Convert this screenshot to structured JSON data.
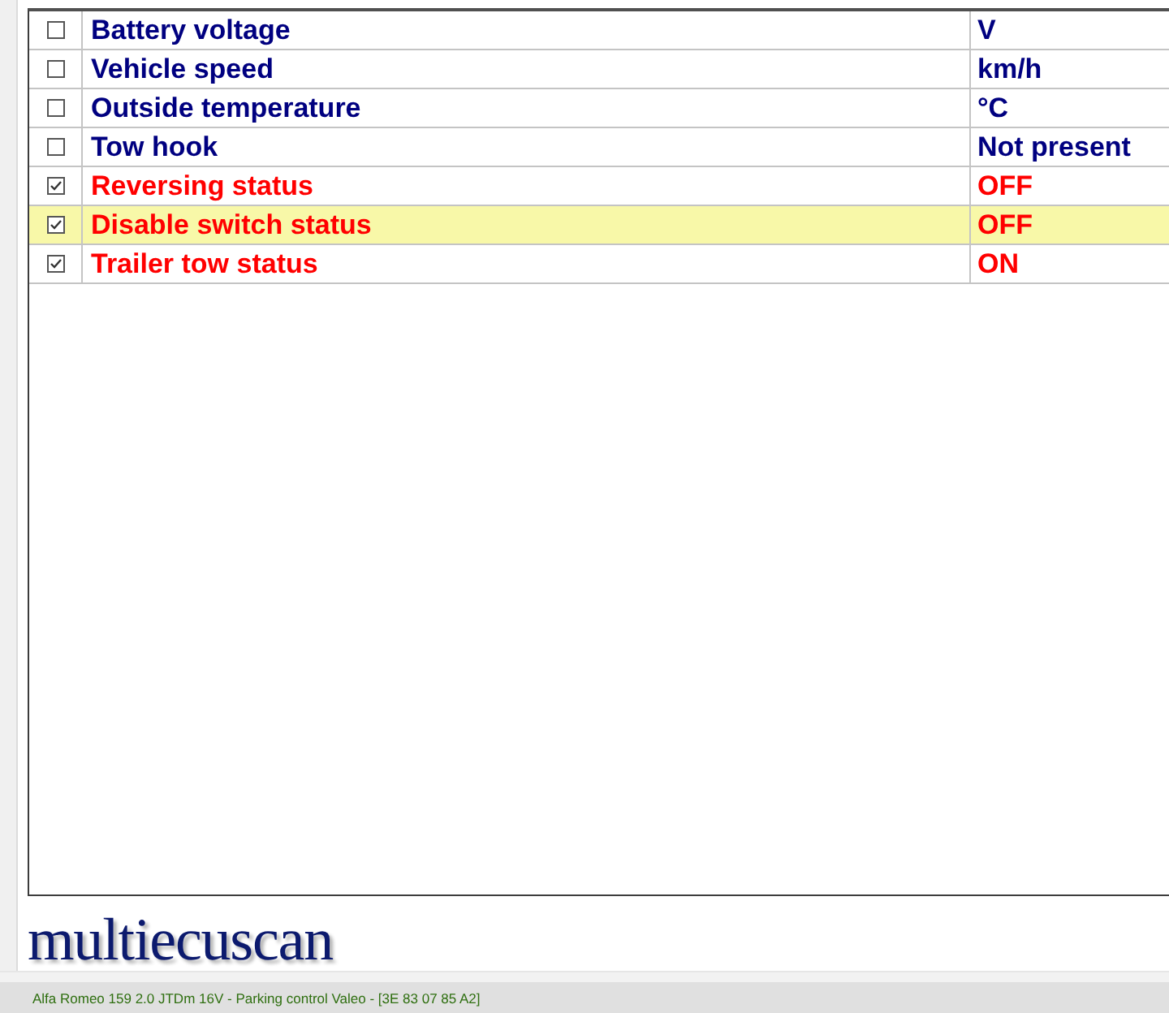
{
  "parameters": [
    {
      "name": "Battery voltage",
      "value": "V",
      "checked": false,
      "selected": false
    },
    {
      "name": "Vehicle speed",
      "value": "km/h",
      "checked": false,
      "selected": false
    },
    {
      "name": "Outside temperature",
      "value": "°C",
      "checked": false,
      "selected": false
    },
    {
      "name": "Tow hook",
      "value": "Not present",
      "checked": false,
      "selected": false
    },
    {
      "name": "Reversing status",
      "value": "OFF",
      "checked": true,
      "selected": false
    },
    {
      "name": "Disable switch status",
      "value": "OFF",
      "checked": true,
      "selected": true
    },
    {
      "name": "Trailer tow status",
      "value": "ON",
      "checked": true,
      "selected": false
    }
  ],
  "logo": "multiecuscan",
  "status_bar": "Alfa Romeo 159 2.0 JTDm 16V - Parking control Valeo - [3E 83 07 85 A2]"
}
